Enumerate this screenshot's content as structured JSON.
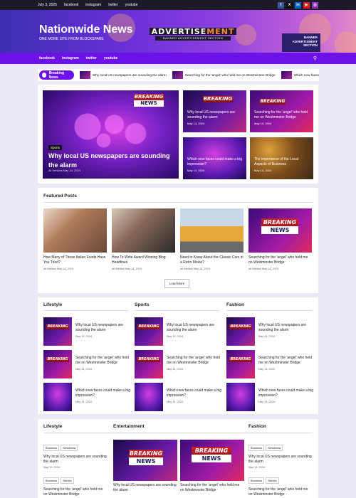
{
  "topbar": {
    "date": "July 3, 2025",
    "links": [
      "facebook",
      "instagram",
      "twitter",
      "youtube"
    ],
    "social": [
      {
        "icon": "facebook-icon",
        "glyph": "f",
        "color": "#3b5998"
      },
      {
        "icon": "x-icon",
        "glyph": "X",
        "color": "#111111"
      },
      {
        "icon": "linkedin-icon",
        "glyph": "in",
        "color": "#0a66c2"
      },
      {
        "icon": "youtube-icon",
        "glyph": "▶",
        "color": "#e02020"
      },
      {
        "icon": "instagram-icon",
        "glyph": "◎",
        "color": "#8a3ab9"
      }
    ]
  },
  "header": {
    "site_title": "Nationwide News",
    "tagline": "ONE MORE SITE FROM BLOCKSPARE",
    "ad_main_1": "ADVERTISE",
    "ad_main_2": "MENT",
    "ad_sub": "BANNER ADVERTISEMENT SECTION",
    "banner_tag": [
      "BANNER",
      "ADVERTISMENT",
      "SECTION"
    ]
  },
  "nav": {
    "items": [
      "facebook",
      "instagram",
      "twitter",
      "youtube"
    ],
    "search_icon": "search-icon"
  },
  "breaking": {
    "label": "Breaking News",
    "items": [
      "Why local US newspapers are sounding the alarm",
      "Searching for the 'angel' who held me on Westminster Bridge",
      "Which new faces"
    ]
  },
  "hero": {
    "category": "Sports",
    "title": "Why local US newspapers are sounding the alarm",
    "meta": "Ali Venkins  May 14, 2024",
    "badge_1": "BREAKING",
    "badge_2": "NEWS"
  },
  "grid": [
    {
      "title": "Why local US newspapers are sounding the alarm",
      "meta": "May 14, 2024"
    },
    {
      "title": "Searching for the 'angel' who held me on Westminster Bridge",
      "meta": "May 14, 2024"
    },
    {
      "title": "Which new faces could make a big impression?",
      "meta": "May 14, 2024"
    },
    {
      "title": "The importance of the Local Aspects of Business",
      "meta": "May 14, 2024"
    }
  ],
  "featured": {
    "title": "Featured Posts",
    "posts": [
      {
        "title": "How Many of These Italian Foods Have You Tried?",
        "meta": "afl Werkes  May 14, 2024"
      },
      {
        "title": "How To Write Award Winning Blog Headlines",
        "meta": "afl Werkes  May 14, 2024"
      },
      {
        "title": "Need to Know About the Classic Cars in a Retro Movie?",
        "meta": "afl Werkes  May 14, 2024"
      },
      {
        "title": "Searching for the 'angel' who held me on Westminster Bridge",
        "meta": "afl Werkes  May 14, 2024"
      }
    ],
    "load_more": "Load More"
  },
  "columns": [
    {
      "title": "Lifestyle",
      "items": [
        {
          "title": "Why local US newspapers are sounding the alarm",
          "meta": "May 14, 2024"
        },
        {
          "title": "Searching for the 'angel' who held me on Westminster Bridge",
          "meta": "May 14, 2024"
        },
        {
          "title": "Which new faces could make a big impression?",
          "meta": "May 14, 2024"
        }
      ]
    },
    {
      "title": "Sports",
      "items": [
        {
          "title": "Why local US newspapers are sounding the alarm",
          "meta": "May 14, 2024"
        },
        {
          "title": "Searching for the 'angel' who held me on Westminster Bridge",
          "meta": "May 14, 2024"
        },
        {
          "title": "Which new faces could make a big impression?",
          "meta": "May 14, 2024"
        }
      ]
    },
    {
      "title": "Fashion",
      "items": [
        {
          "title": "Why local US newspapers are sounding the alarm",
          "meta": "May 14, 2024"
        },
        {
          "title": "Searching for the 'angel' who held me on Westminster Bridge",
          "meta": "May 14, 2024"
        },
        {
          "title": "Which new faces could make a big impression?",
          "meta": "May 14, 2024"
        }
      ]
    }
  ],
  "bottom": {
    "lifestyle": {
      "title": "Lifestyle",
      "tags1": [
        "Business",
        "Newsbeat"
      ],
      "item1": "Why local US newspapers are sounding the alarm",
      "meta1": "May 15, 2024",
      "tags2": [
        "Business",
        "Stories"
      ],
      "item2": "Searching for the 'angel' who held me on Westminster Bridge"
    },
    "entertainment": {
      "title": "Entertainment",
      "item1": "Why local US newspapers are sounding the alarm",
      "item2": "Searching for the 'angel' who held me on Westminster Bridge"
    },
    "fashion": {
      "title": "Fashion",
      "tags1": [
        "Business",
        "Newsbeat"
      ],
      "item1": "Why local US newspapers are sounding the alarm",
      "meta1": "May 14, 2024",
      "tags2": [
        "Business",
        "Stories"
      ],
      "item2": "Searching for the 'angel' who held me on Westminster Bridge"
    }
  }
}
